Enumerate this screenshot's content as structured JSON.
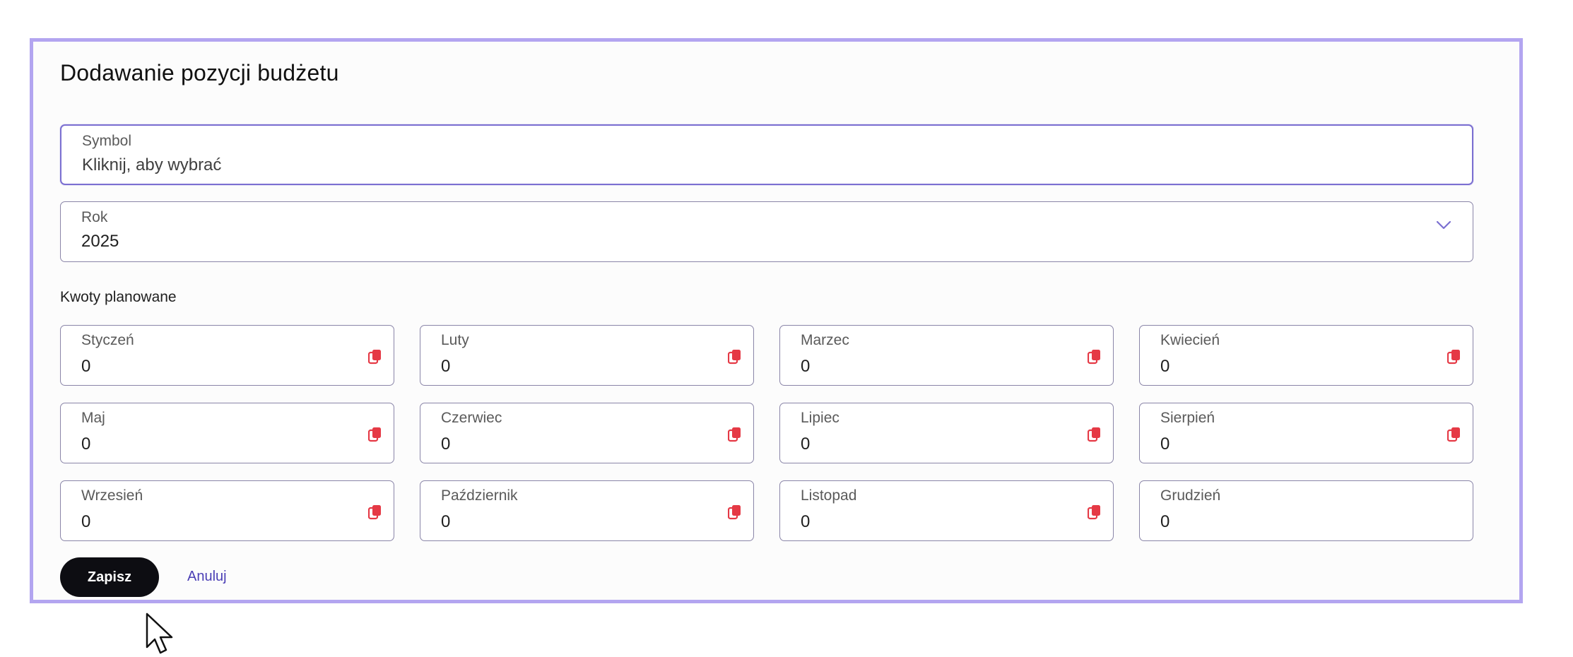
{
  "form": {
    "title": "Dodawanie pozycji budżetu",
    "symbol": {
      "label": "Symbol",
      "placeholder": "Kliknij, aby wybrać"
    },
    "year": {
      "label": "Rok",
      "value": "2025"
    },
    "planned_label": "Kwoty planowane",
    "months": [
      {
        "label": "Styczeń",
        "value": "0"
      },
      {
        "label": "Luty",
        "value": "0"
      },
      {
        "label": "Marzec",
        "value": "0"
      },
      {
        "label": "Kwiecień",
        "value": "0"
      },
      {
        "label": "Maj",
        "value": "0"
      },
      {
        "label": "Czerwiec",
        "value": "0"
      },
      {
        "label": "Lipiec",
        "value": "0"
      },
      {
        "label": "Sierpień",
        "value": "0"
      },
      {
        "label": "Wrzesień",
        "value": "0"
      },
      {
        "label": "Październik",
        "value": "0"
      },
      {
        "label": "Listopad",
        "value": "0"
      },
      {
        "label": "Grudzień",
        "value": "0"
      }
    ],
    "save_label": "Zapisz",
    "cancel_label": "Anuluj"
  },
  "colors": {
    "accent": "#b3a5f0",
    "copy_icon": "#e53945",
    "button_bg": "#0d0d12",
    "link": "#4b3fb5"
  },
  "icons": {
    "year_dropdown": "chevron-down-icon",
    "month_copy": "copy-icon",
    "pointer": "mouse-pointer-icon"
  }
}
